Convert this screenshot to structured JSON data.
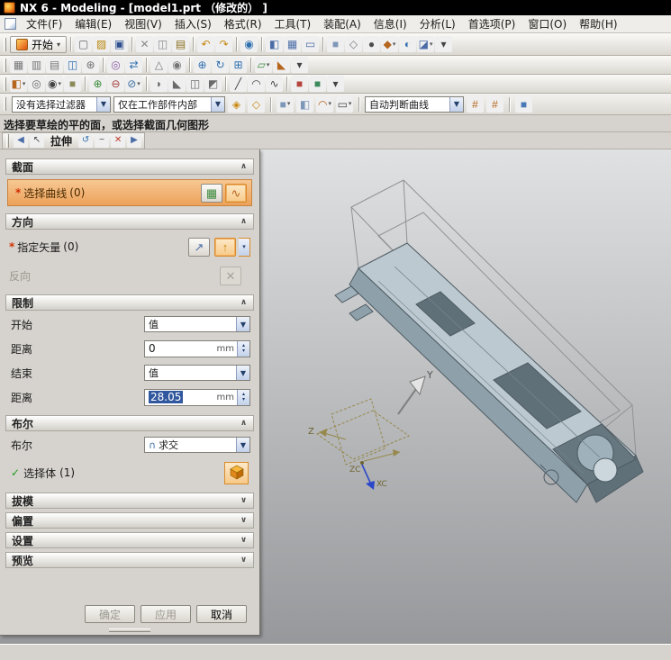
{
  "window": {
    "title": "NX 6 - Modeling - [model1.prt （修改的） ]"
  },
  "menubar": {
    "items": [
      "文件(F)",
      "编辑(E)",
      "视图(V)",
      "插入(S)",
      "格式(R)",
      "工具(T)",
      "装配(A)",
      "信息(I)",
      "分析(L)",
      "首选项(P)",
      "窗口(O)",
      "帮助(H)"
    ]
  },
  "ui": {
    "caret": "▾",
    "combo_arrow": "▼",
    "spin_up": "▴",
    "spin_down": "▾",
    "chevron_up": "∧",
    "chevron_down": "∨",
    "sketch_grid_glyph": "▦",
    "curve_glyph": "∿",
    "vector_dialog_glyph": "↗",
    "inferred_vector_glyph": "↑",
    "reverse_glyph": "✕"
  },
  "toolbars": {
    "start_label": "开始",
    "row1": [
      {
        "name": "new-icon",
        "glyph": "▢",
        "fg": "#666666"
      },
      {
        "name": "open-icon",
        "glyph": "▨",
        "fg": "#b8860b"
      },
      {
        "name": "save-icon",
        "glyph": "▣",
        "fg": "#2f4f8f"
      },
      {
        "sep": true
      },
      {
        "name": "cut-icon",
        "glyph": "✕",
        "fg": "#8a8a8a"
      },
      {
        "name": "copy-icon",
        "glyph": "◫",
        "fg": "#8a8a8a"
      },
      {
        "name": "paste-icon",
        "glyph": "▤",
        "fg": "#8a6d1e"
      },
      {
        "sep": true
      },
      {
        "name": "undo-icon",
        "glyph": "↶",
        "fg": "#c98a12"
      },
      {
        "name": "redo-icon",
        "glyph": "↷",
        "fg": "#c98a12"
      },
      {
        "sep": true
      },
      {
        "name": "command-finder-icon",
        "glyph": "◉",
        "fg": "#2f6faf"
      },
      {
        "sep": true
      },
      {
        "name": "window-cascade-icon",
        "glyph": "◧",
        "fg": "#4a6da7"
      },
      {
        "name": "window-tile-icon",
        "glyph": "▦",
        "fg": "#4a6da7"
      },
      {
        "name": "new-window-icon",
        "glyph": "▭",
        "fg": "#4a6da7"
      },
      {
        "sep": true
      },
      {
        "name": "shaded-view-icon",
        "glyph": "■",
        "fg": "#7d97b8"
      },
      {
        "name": "wireframe-view-icon",
        "glyph": "◇",
        "fg": "#777777"
      },
      {
        "name": "sphere-icon",
        "glyph": "●",
        "fg": "#4c4c4c"
      },
      {
        "name": "orient-view-icon",
        "glyph": "◆",
        "fg": "#b5651d",
        "dd": true
      },
      {
        "name": "snap-view-icon",
        "glyph": "◐",
        "fg": "#2f6faf"
      },
      {
        "name": "render-style-icon",
        "glyph": "◪",
        "fg": "#4a6da7",
        "dd": true
      },
      {
        "name": "toolbar-options-icon",
        "glyph": "▾",
        "fg": "#444444"
      }
    ],
    "row2": [
      {
        "name": "view-layout-icon",
        "glyph": "▦",
        "fg": "#777777"
      },
      {
        "name": "part-navigator-icon",
        "glyph": "▥",
        "fg": "#777777"
      },
      {
        "name": "assembly-navigator-icon",
        "glyph": "▤",
        "fg": "#777777"
      },
      {
        "name": "roles-icon",
        "glyph": "◫",
        "fg": "#2f6faf"
      },
      {
        "name": "gear-icon",
        "glyph": "⊛",
        "fg": "#6a6a6a"
      },
      {
        "sep": true
      },
      {
        "name": "show-hide-icon",
        "glyph": "◎",
        "fg": "#8a5aa0"
      },
      {
        "name": "move-object-icon",
        "glyph": "⇄",
        "fg": "#2f6faf"
      },
      {
        "sep": true
      },
      {
        "name": "measure-icon",
        "glyph": "△",
        "fg": "#777777"
      },
      {
        "name": "snapshot-icon",
        "glyph": "◉",
        "fg": "#777777"
      },
      {
        "sep": true
      },
      {
        "name": "zoom-in-icon",
        "glyph": "⊕",
        "fg": "#2f6faf"
      },
      {
        "name": "rotate-view-icon",
        "glyph": "↻",
        "fg": "#2f6faf"
      },
      {
        "name": "fit-view-icon",
        "glyph": "⊞",
        "fg": "#2f6faf"
      },
      {
        "sep": true
      },
      {
        "name": "datum-plane-icon",
        "glyph": "▱",
        "fg": "#3c8a3c",
        "dd": true
      },
      {
        "name": "sketch-icon",
        "glyph": "◣",
        "fg": "#b5651d"
      },
      {
        "name": "toolbar-options-icon",
        "glyph": "▾",
        "fg": "#444444"
      }
    ],
    "row3": [
      {
        "name": "extrude-icon",
        "glyph": "◧",
        "fg": "#b5651d",
        "dd": true
      },
      {
        "name": "revolve-icon",
        "glyph": "◎",
        "fg": "#6a6a6a"
      },
      {
        "name": "hole-icon",
        "glyph": "◉",
        "fg": "#444444",
        "dd": true
      },
      {
        "name": "block-icon",
        "glyph": "■",
        "fg": "#8a8a5a"
      },
      {
        "sep": true
      },
      {
        "name": "unite-icon",
        "glyph": "⊕",
        "fg": "#3c8a3c"
      },
      {
        "name": "subtract-icon",
        "glyph": "⊖",
        "fg": "#a33c3c"
      },
      {
        "name": "intersect-icon",
        "glyph": "⊘",
        "fg": "#3c6fa3",
        "dd": true
      },
      {
        "sep": true
      },
      {
        "name": "edge-blend-icon",
        "glyph": "◗",
        "fg": "#6a6a6a"
      },
      {
        "name": "chamfer-icon",
        "glyph": "◣",
        "fg": "#6a6a6a"
      },
      {
        "name": "shell-icon",
        "glyph": "◫",
        "fg": "#6a6a6a"
      },
      {
        "name": "trim-body-icon",
        "glyph": "◩",
        "fg": "#6a6a6a"
      },
      {
        "sep": true
      },
      {
        "name": "line-icon",
        "glyph": "╱",
        "fg": "#444444"
      },
      {
        "name": "arc-icon",
        "glyph": "◠",
        "fg": "#444444"
      },
      {
        "name": "spline-icon",
        "glyph": "∿",
        "fg": "#444444"
      },
      {
        "sep": true
      },
      {
        "name": "color-red-chip-icon",
        "glyph": "■",
        "fg": "#b5443c"
      },
      {
        "name": "color-green-chip-icon",
        "glyph": "■",
        "fg": "#3c8a5a"
      },
      {
        "name": "toolbar-options-icon",
        "glyph": "▾",
        "fg": "#444444"
      }
    ]
  },
  "selection_bar": {
    "filter_value": "没有选择过滤器",
    "scope_value": "仅在工作部件内部",
    "curve_rule_value": "自动判断曲线",
    "icons_a": [
      {
        "name": "snap-point-icon",
        "glyph": "◈",
        "fg": "#c98a12"
      },
      {
        "name": "magnet-icon",
        "glyph": "◇",
        "fg": "#c98a12"
      },
      {
        "sep": true
      },
      {
        "name": "select-solid-icon",
        "glyph": "■",
        "fg": "#7d97b8",
        "dd": true
      },
      {
        "name": "select-face-icon",
        "glyph": "◧",
        "fg": "#7d97b8"
      },
      {
        "name": "select-curve-icon",
        "glyph": "◠",
        "fg": "#b5651d",
        "dd": true
      },
      {
        "name": "rectangle-select-icon",
        "glyph": "▭",
        "fg": "#444444",
        "dd": true
      },
      {
        "sep": true
      }
    ],
    "icons_b": [
      {
        "name": "stop-at-intersection-icon",
        "glyph": "#",
        "fg": "#b5651d"
      },
      {
        "name": "snap-fence-icon",
        "glyph": "#",
        "fg": "#b5651d"
      },
      {
        "sep": true
      },
      {
        "name": "shaded-cube-icon",
        "glyph": "■",
        "fg": "#4a7ab5"
      }
    ]
  },
  "prompt_bar": {
    "text": "选择要草绘的平的面，或选择截面几何图形"
  },
  "dialog_bar": {
    "title": "拉伸",
    "icons_left": [
      {
        "name": "dialog-back-icon",
        "glyph": "◀",
        "fg": "#4a6da7"
      },
      {
        "name": "dialog-select-icon",
        "glyph": "↖",
        "fg": "#444444"
      }
    ],
    "icons_right": [
      {
        "name": "dialog-reset-icon",
        "glyph": "↺",
        "fg": "#2f6faf"
      },
      {
        "name": "dialog-minimize-icon",
        "glyph": "−",
        "fg": "#444444"
      },
      {
        "name": "dialog-close-icon",
        "glyph": "✕",
        "fg": "#c0392b"
      },
      {
        "name": "dialog-forward-icon",
        "glyph": "▶",
        "fg": "#4a6da7"
      }
    ]
  },
  "dialog": {
    "section": {
      "title": "截面",
      "star": "*",
      "select_label": "选择曲线",
      "select_count": "(0)"
    },
    "direction": {
      "title": "方向",
      "star": "*",
      "vector_label": "指定矢量",
      "vector_count": "(0)",
      "reverse_label": "反向"
    },
    "limits": {
      "title": "限制",
      "start_label": "开始",
      "start_option": "值",
      "start_dist_label": "距离",
      "start_dist_value": "0",
      "start_dist_unit": "mm",
      "end_label": "结束",
      "end_option": "值",
      "end_dist_label": "距离",
      "end_dist_value": "28.05",
      "end_dist_unit": "mm"
    },
    "boolean": {
      "title": "布尔",
      "label": "布尔",
      "option": "求交",
      "option_glyph": "∩",
      "check": "✓",
      "body_label": "选择体",
      "body_count": "(1)"
    },
    "collapsed": [
      {
        "title": "拔模",
        "chev": "∨"
      },
      {
        "title": "偏置",
        "chev": "∨"
      },
      {
        "title": "设置",
        "chev": "∨"
      },
      {
        "title": "预览",
        "chev": "∨"
      }
    ],
    "buttons": {
      "ok": "确定",
      "apply": "应用",
      "cancel": "取消"
    }
  },
  "viewport": {
    "axis_labels": {
      "y": "Y",
      "z": "Z",
      "zc": "ZC",
      "xc": "XC"
    }
  }
}
